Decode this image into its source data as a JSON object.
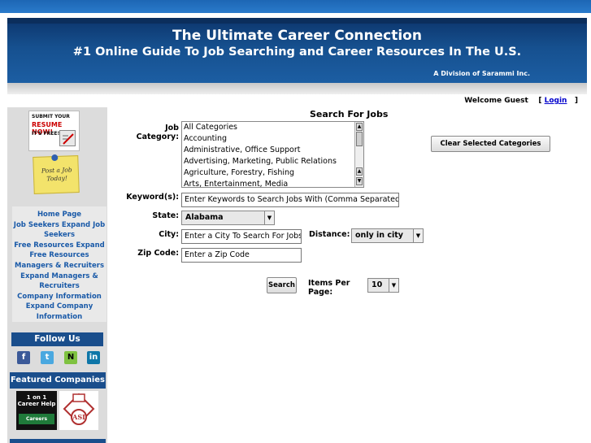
{
  "header": {
    "title": "The Ultimate Career Connection",
    "subtitle": "#1 Online Guide To Job Searching and Career Resources In The U.S.",
    "division": "A Division of Sarammi Inc."
  },
  "welcome": {
    "text": "Welcome Guest",
    "bracket_open": "[",
    "login": "Login",
    "bracket_close": "]"
  },
  "sidebar": {
    "promo_resume": {
      "line1": "SUBMIT YOUR",
      "line2": "RESUME NOW!",
      "line3": "IT'S FREE!"
    },
    "promo_post": {
      "text": "Post a Job Today!"
    },
    "nav": [
      "Home Page",
      "Job Seekers Expand Job Seekers",
      "Free Resources Expand Free Resources",
      "Managers & Recruiters Expand Managers & Recruiters",
      "Company Information Expand Company Information"
    ],
    "follow_us": "Follow Us",
    "socials": [
      "f",
      "t",
      "N",
      "in"
    ],
    "featured": "Featured Companies",
    "company1": {
      "line1": "1 on 1",
      "line2": "Career Help",
      "badge": "Careers"
    },
    "company2": {
      "logo_text": "ASI"
    }
  },
  "search": {
    "title": "Search For Jobs",
    "job_category_label": "Job Category:",
    "categories": [
      "All Categories",
      "Accounting",
      "Administrative, Office Support",
      "Advertising, Marketing, Public Relations",
      "Agriculture, Forestry, Fishing",
      "Arts, Entertainment, Media"
    ],
    "clear_button": "Clear Selected Categories",
    "keywords_label": "Keyword(s):",
    "keywords_value": "Enter Keywords to Search Jobs With (Comma Separated)",
    "state_label": "State:",
    "state_value": "Alabama",
    "city_label": "City:",
    "city_value": "Enter a City To Search For Jobs",
    "distance_label": "Distance:",
    "distance_value": "only in city",
    "zip_label": "Zip Code:",
    "zip_value": "Enter a Zip Code",
    "search_button": "Search",
    "items_per_page_label": "Items Per Page:",
    "items_per_page_value": "10"
  },
  "colors": {
    "header_blue": "#16508f",
    "nav_link": "#1a5aa8",
    "sidebar_bg": "#dcdcdc"
  }
}
